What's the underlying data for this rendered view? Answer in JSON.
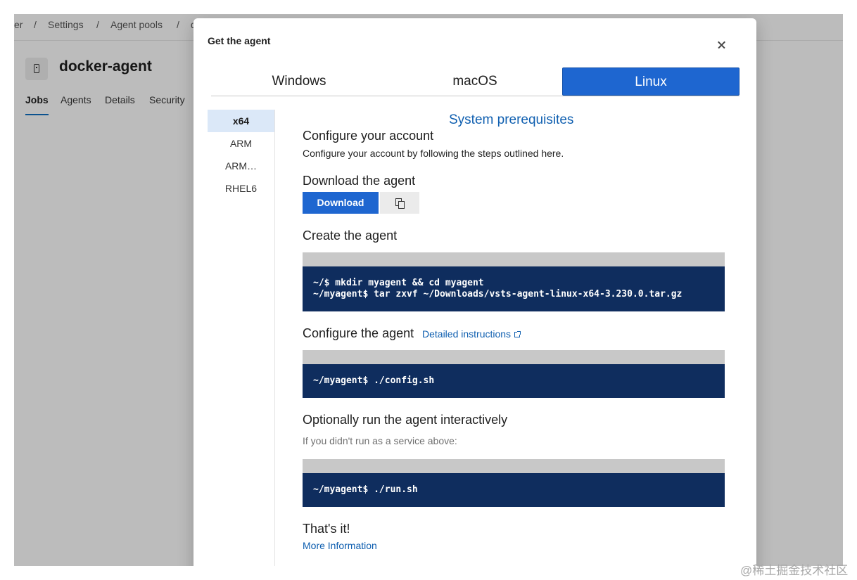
{
  "background_page": {
    "breadcrumb": [
      "er",
      "/",
      "Settings",
      "/",
      "Agent pools",
      "/",
      "d"
    ],
    "title": "docker-agent",
    "icon": "agent-device-icon",
    "tabs": [
      {
        "label": "Jobs",
        "active": true
      },
      {
        "label": "Agents",
        "active": false
      },
      {
        "label": "Details",
        "active": false
      },
      {
        "label": "Security",
        "active": false
      }
    ]
  },
  "dialog": {
    "title": "Get the agent",
    "close_icon": "close-icon",
    "os_tabs": [
      {
        "label": "Windows",
        "selected": false
      },
      {
        "label": "macOS",
        "selected": false
      },
      {
        "label": "Linux",
        "selected": true
      }
    ],
    "architectures": [
      {
        "label": "x64",
        "selected": true
      },
      {
        "label": "ARM",
        "selected": false
      },
      {
        "label": "ARM…",
        "selected": false
      },
      {
        "label": "RHEL6",
        "selected": false
      }
    ],
    "prereq_link": "System prerequisites",
    "sections": {
      "configure_account_heading": "Configure your account",
      "configure_account_text": "Configure your account by following the steps outlined here.",
      "download_heading": "Download the agent",
      "download_button": "Download",
      "copy_icon": "copy-icon",
      "create_heading": "Create the agent",
      "create_code": [
        "~/$ mkdir myagent && cd myagent",
        "~/myagent$ tar zxvf ~/Downloads/vsts-agent-linux-x64-3.230.0.tar.gz"
      ],
      "configure_heading": "Configure the agent",
      "detailed_instructions": "Detailed instructions",
      "configure_code": "~/myagent$ ./config.sh",
      "run_heading": "Optionally run the agent interactively",
      "run_text": "If you didn't run as a service above:",
      "run_code": "~/myagent$ ./run.sh",
      "done_heading": "That's it!",
      "more_info": "More Information"
    }
  },
  "watermark": "@稀土掘金技术社区",
  "colors": {
    "accent": "#1e66d0",
    "code_bg": "#0f2d5e",
    "link": "#0f5fb0"
  }
}
